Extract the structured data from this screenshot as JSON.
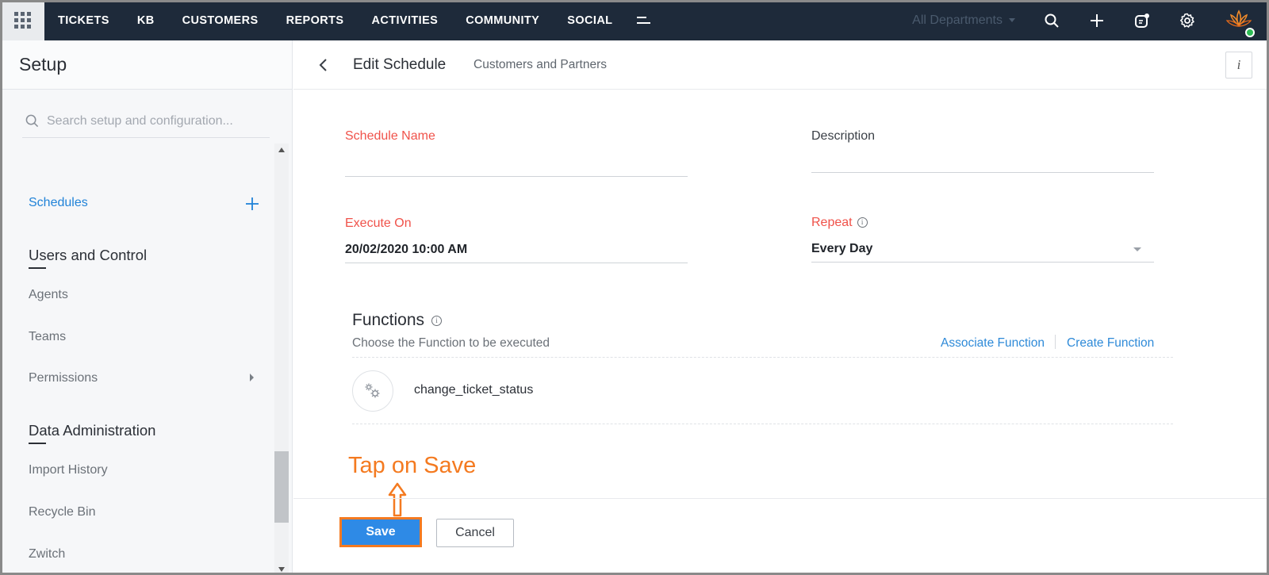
{
  "topnav": {
    "items": [
      "TICKETS",
      "KB",
      "CUSTOMERS",
      "REPORTS",
      "ACTIVITIES",
      "COMMUNITY",
      "SOCIAL"
    ],
    "department": "All Departments",
    "icons": [
      "apps-grid-icon",
      "more-menu-icon",
      "search-icon",
      "plus-icon",
      "notification-icon",
      "gear-icon",
      "avatar"
    ]
  },
  "sidebar": {
    "title": "Setup",
    "search_placeholder": "Search setup and configuration...",
    "active_item": "Schedules",
    "heading_users": "Users and Control",
    "users_items": [
      "Agents",
      "Teams",
      "Permissions"
    ],
    "heading_data": "Data Administration",
    "data_items": [
      "Import History",
      "Recycle Bin",
      "Zwitch"
    ]
  },
  "main": {
    "title": "Edit Schedule",
    "subtitle": "Customers and Partners",
    "fields": {
      "schedule_name_label": "Schedule Name",
      "schedule_name_value": "",
      "description_label": "Description",
      "description_value": "",
      "execute_on_label": "Execute On",
      "execute_on_value": "20/02/2020 10:00 AM",
      "repeat_label": "Repeat",
      "repeat_value": "Every Day"
    },
    "functions": {
      "title": "Functions",
      "subtitle": "Choose the Function to be executed",
      "associate_link": "Associate Function",
      "create_link": "Create Function",
      "items": [
        "change_ticket_status"
      ]
    },
    "annotation": "Tap on Save",
    "buttons": {
      "save": "Save",
      "cancel": "Cancel"
    }
  },
  "colors": {
    "topbar": "#1e2a3a",
    "accent_blue": "#2e8ae6",
    "required_red": "#f0524a",
    "annotation_orange": "#f47a20",
    "active_link": "#2183d8"
  }
}
